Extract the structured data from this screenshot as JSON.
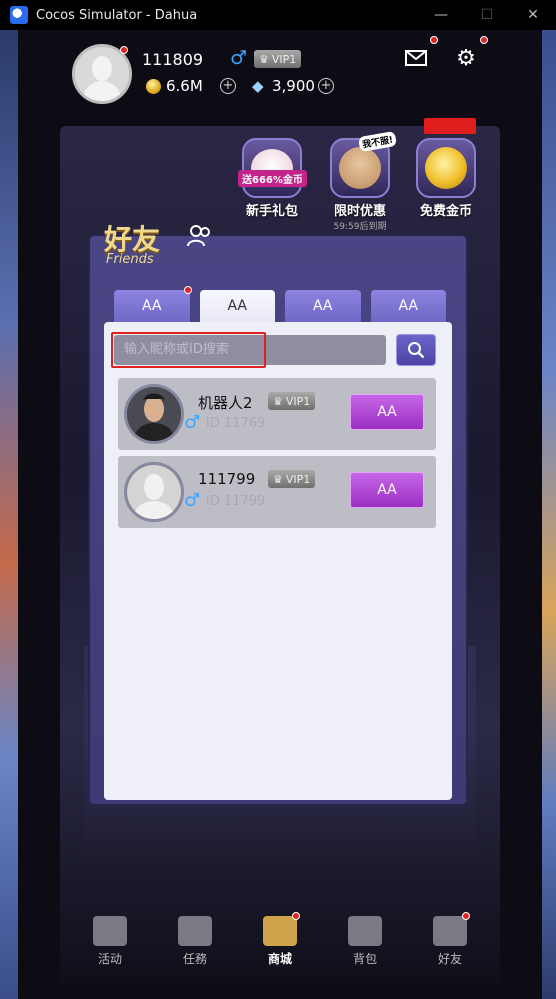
{
  "window": {
    "title": "Cocos Simulator - Dahua",
    "minimize": "—",
    "maximize": "☐",
    "close": "✕"
  },
  "player": {
    "name": "111809",
    "gender": "♂",
    "vip": "VIP1",
    "gold": "6.6M",
    "diamonds": "3,900"
  },
  "promos": [
    {
      "label": "新手礼包",
      "ribbon": "送666%金币"
    },
    {
      "label": "限时优惠",
      "bubble": "我不服!",
      "timer": "59:59后到期"
    },
    {
      "label": "免费金币"
    }
  ],
  "friends": {
    "title_cn": "好友",
    "title_en": "Friends"
  },
  "tabs": [
    "AA",
    "AA",
    "AA",
    "AA"
  ],
  "search": {
    "placeholder": "输入昵称或ID搜索"
  },
  "friend_rows": [
    {
      "name": "机器人2",
      "vip": "VIP1",
      "id": "ID  11769",
      "action": "AA"
    },
    {
      "name": "111799",
      "vip": "VIP1",
      "id": "ID  11799",
      "action": "AA"
    }
  ],
  "nav": [
    "活动",
    "任務",
    "商城",
    "背包",
    "好友"
  ],
  "colors": {
    "accent": "#6f67c4",
    "button": "#9a2fc2",
    "dot": "#e02424"
  }
}
